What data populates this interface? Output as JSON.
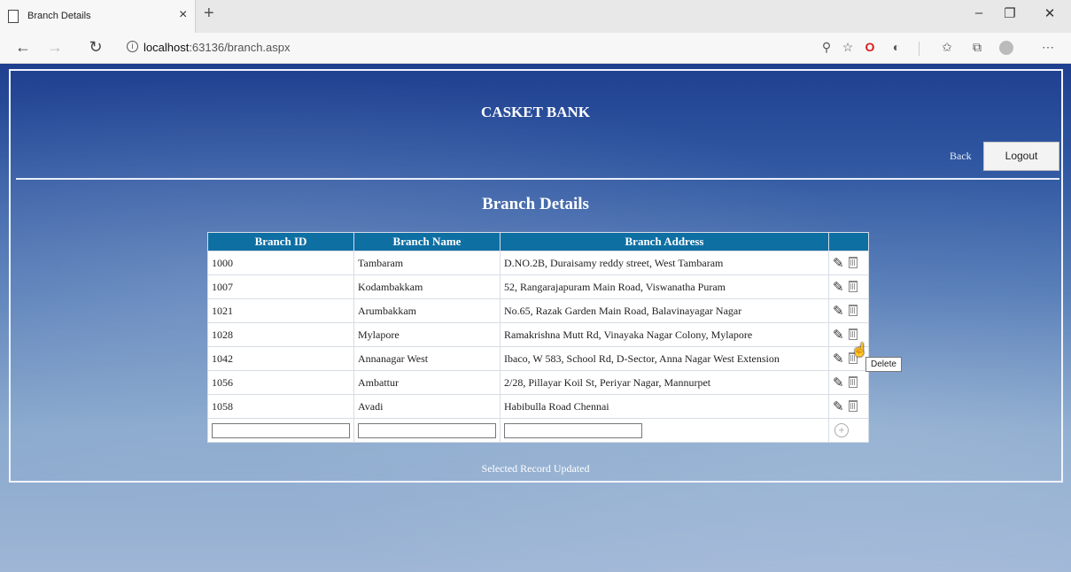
{
  "browser": {
    "tab_title": "Branch Details",
    "tab_close": "×",
    "new_tab": "+",
    "url_host": "localhost",
    "url_rest": ":63136/branch.aspx",
    "window_controls": {
      "minimize": "–",
      "restore": "❐",
      "close": "✕"
    },
    "nav": {
      "back": "←",
      "forward": "→",
      "refresh": "↻"
    }
  },
  "header": {
    "bank_name": "CASKET BANK",
    "back_label": "Back",
    "logout_label": "Logout"
  },
  "main": {
    "heading": "Branch Details",
    "columns": [
      "Branch ID",
      "Branch Name",
      "Branch Address",
      ""
    ],
    "rows": [
      {
        "id": "1000",
        "name": "Tambaram",
        "address": "D.NO.2B, Duraisamy reddy street, West Tambaram"
      },
      {
        "id": "1007",
        "name": "Kodambakkam",
        "address": "52, Rangarajapuram Main Road, Viswanatha Puram"
      },
      {
        "id": "1021",
        "name": "Arumbakkam",
        "address": "No.65, Razak Garden Main Road, Balavinayagar Nagar"
      },
      {
        "id": "1028",
        "name": "Mylapore",
        "address": "Ramakrishna Mutt Rd, Vinayaka Nagar Colony, Mylapore"
      },
      {
        "id": "1042",
        "name": "Annanagar West",
        "address": "Ibaco, W 583, School Rd, D-Sector, Anna Nagar West Extension"
      },
      {
        "id": "1056",
        "name": "Ambattur",
        "address": "2/28, Pillayar Koil St, Periyar Nagar, Mannurpet"
      },
      {
        "id": "1058",
        "name": "Avadi",
        "address": "Habibulla Road Chennai"
      }
    ],
    "new_row": {
      "id_value": "",
      "name_value": "",
      "address_value": ""
    },
    "tooltip": "Delete",
    "status_message": "Selected Record Updated"
  },
  "icons": {
    "edit": "pencil-icon",
    "delete": "trash-icon",
    "add": "plus-circle-icon"
  },
  "colors": {
    "header_row": "#0e6fa3",
    "page_bg_top": "#1f3f8f",
    "page_bg_bottom": "#9fb6d6"
  }
}
